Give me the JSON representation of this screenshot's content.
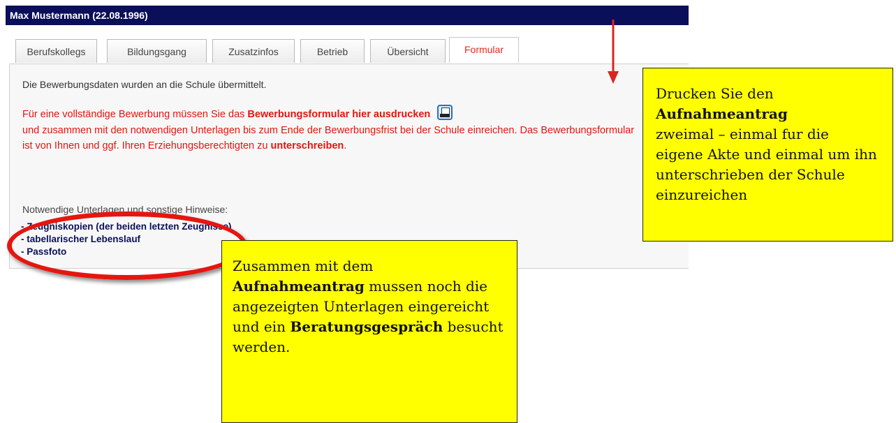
{
  "header": {
    "title": "Max Mustermann (22.08.1996)"
  },
  "tabs": [
    {
      "label": "Berufskollegs"
    },
    {
      "label": "Bildungsgang"
    },
    {
      "label": "Zusatzinfos"
    },
    {
      "label": "Betrieb"
    },
    {
      "label": "Übersicht"
    },
    {
      "label": "Formular",
      "active": true
    }
  ],
  "panel": {
    "info": "Die Bewerbungsdaten wurden an die Schule übermittelt.",
    "red_part1": "Für eine vollständige Bewerbung müssen Sie das ",
    "red_bold1": "Bewerbungsformular hier ausdrucken",
    "red_part2": "und zusammen mit den notwendigen Unterlagen bis zum Ende der Bewerbungsfrist bei der Schule einreichen. Das Bewerbungsformular ist von Ihnen und ggf. Ihren Erziehungsberechtigten zu ",
    "red_bold2": "unterschreiben",
    "red_end": ".",
    "print_icon": "printer-icon",
    "hints_heading": "Notwendige Unterlagen und sonstige Hinweise:",
    "documents": [
      "- Zeugniskopien (der beiden letzten Zeugnisse)",
      "- tabellarischer Lebenslauf",
      "- Passfoto"
    ]
  },
  "callout_right": {
    "line1": "Drucken Sie den",
    "bold": "Aufnahmeantrag",
    "rest": "zweimal – einmal fur die eigene Akte und einmal um ihn unterschrieben der Schule einzureichen"
  },
  "callout_bottom": {
    "part1": "Zusammen mit dem",
    "bold1": "Aufnahmeantrag",
    "part2": " mussen noch die angezeigten Unterlagen eingereicht  und ein ",
    "bold2": "Beratungsgespräch",
    "part3": " besucht werden."
  },
  "colors": {
    "header_bg": "#0b0f5a",
    "red_text": "#e3160f",
    "callout_bg": "#ffff00",
    "active_tab": "#e8291c"
  }
}
